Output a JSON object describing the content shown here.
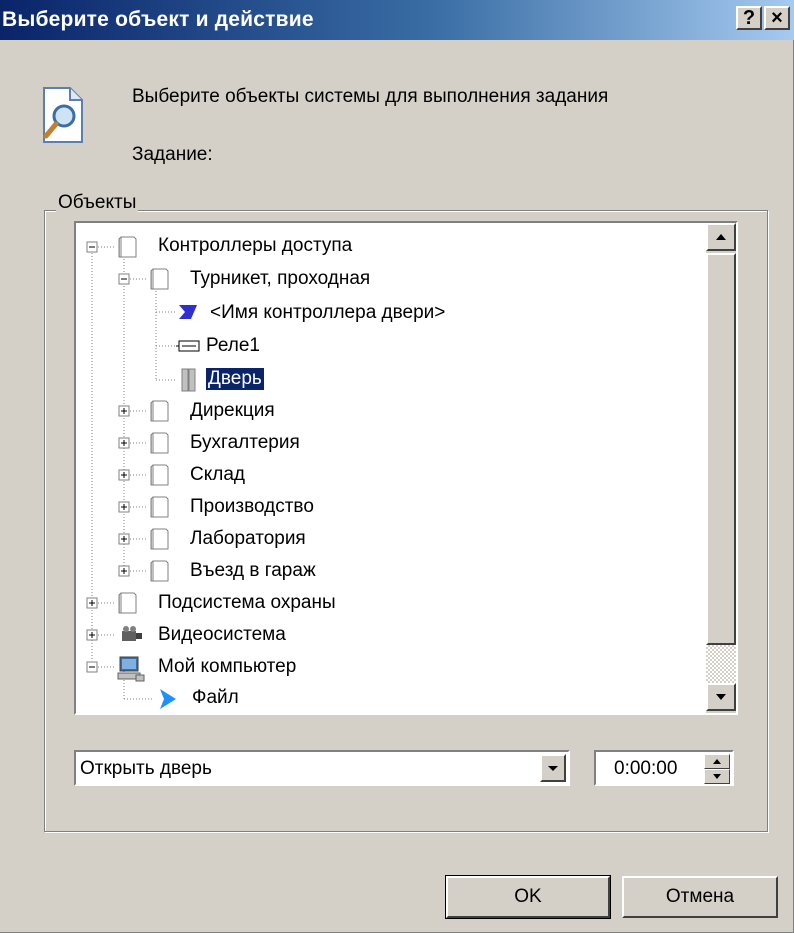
{
  "window": {
    "title": "Выберите объект и действие",
    "help_label": "?",
    "close_label": "×"
  },
  "header": {
    "description": "Выберите объекты системы для выполнения задания",
    "task_label": "Задание:"
  },
  "objects_group": {
    "label": "Объекты"
  },
  "tree": {
    "items": [
      {
        "label": "Контроллеры доступа",
        "icon": "folder-icon",
        "expander": "minus"
      },
      {
        "label": "Турникет, проходная",
        "icon": "folder-icon",
        "expander": "minus"
      },
      {
        "label": "<Имя контроллера двери>",
        "icon": "door-controller-icon",
        "expander": "none"
      },
      {
        "label": "Реле1",
        "icon": "relay-icon",
        "expander": "none"
      },
      {
        "label": "Дверь",
        "icon": "door-icon",
        "expander": "none",
        "selected": true
      },
      {
        "label": "Дирекция",
        "icon": "folder-icon",
        "expander": "plus"
      },
      {
        "label": "Бухгалтерия",
        "icon": "folder-icon",
        "expander": "plus"
      },
      {
        "label": "Склад",
        "icon": "folder-icon",
        "expander": "plus"
      },
      {
        "label": "Производство",
        "icon": "folder-icon",
        "expander": "plus"
      },
      {
        "label": "Лаборатория",
        "icon": "folder-icon",
        "expander": "plus"
      },
      {
        "label": "Въезд в гараж",
        "icon": "folder-icon",
        "expander": "plus"
      },
      {
        "label": "Подсистема охраны",
        "icon": "folder-icon",
        "expander": "plus"
      },
      {
        "label": "Видеосистема",
        "icon": "camera-icon",
        "expander": "plus"
      },
      {
        "label": "Мой компьютер",
        "icon": "computer-icon",
        "expander": "minus"
      },
      {
        "label": "Файл",
        "icon": "file-arrow-icon",
        "expander": "none"
      }
    ]
  },
  "action": {
    "selected": "Открыть дверь",
    "delay": "0:00:00"
  },
  "buttons": {
    "ok": "OK",
    "cancel": "Отмена"
  },
  "colors": {
    "titlebar": "#0a246a",
    "face": "#d4d0c8",
    "selection": "#0a246a"
  }
}
